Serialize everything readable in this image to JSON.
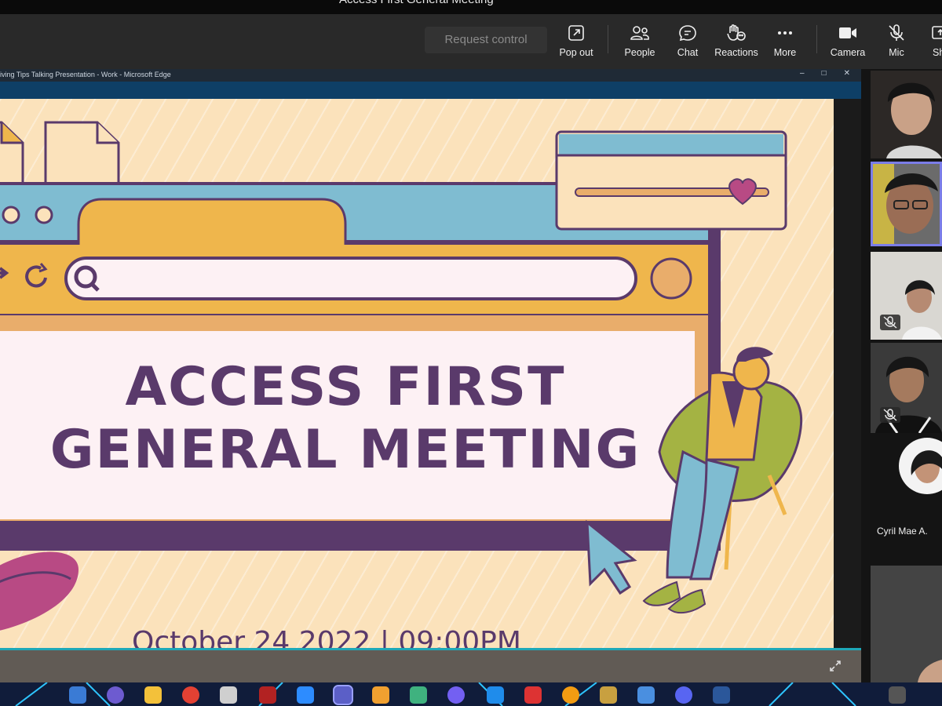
{
  "meeting": {
    "title": "Access First General Meeting"
  },
  "toolbar": {
    "request_control": "Request control",
    "items": [
      {
        "label": "Pop out",
        "icon": "pop-out-icon"
      },
      {
        "label": "People",
        "icon": "people-icon"
      },
      {
        "label": "Chat",
        "icon": "chat-icon"
      },
      {
        "label": "Reactions",
        "icon": "reactions-icon"
      },
      {
        "label": "More",
        "icon": "more-icon"
      },
      {
        "label": "Camera",
        "icon": "camera-icon"
      },
      {
        "label": "Mic",
        "icon": "mic-off-icon"
      },
      {
        "label": "Sh",
        "icon": "share-icon"
      }
    ]
  },
  "shared_window": {
    "title": "iving Tips Talking Presentation - Work - Microsoft Edge",
    "controls": [
      "–",
      "□",
      "✕"
    ]
  },
  "slide": {
    "heading_line1": "ACCESS FIRST",
    "heading_line2": "GENERAL MEETING",
    "date_line": "October 24 2022 | 09:00PM"
  },
  "participants": [
    {
      "id": "p1",
      "muted": false
    },
    {
      "id": "p2",
      "muted": false,
      "active_speaker": true
    },
    {
      "id": "p3",
      "muted": true
    },
    {
      "id": "p4",
      "muted": true
    },
    {
      "id": "p5",
      "name": "Cyril Mae A.",
      "avatar": true
    },
    {
      "id": "p6",
      "muted": false
    }
  ],
  "colors": {
    "slide_bg": "#fbe2bb",
    "heading": "#5a3a6b",
    "accent_teal": "#1ea8b8",
    "active_border": "#7b7de8"
  }
}
